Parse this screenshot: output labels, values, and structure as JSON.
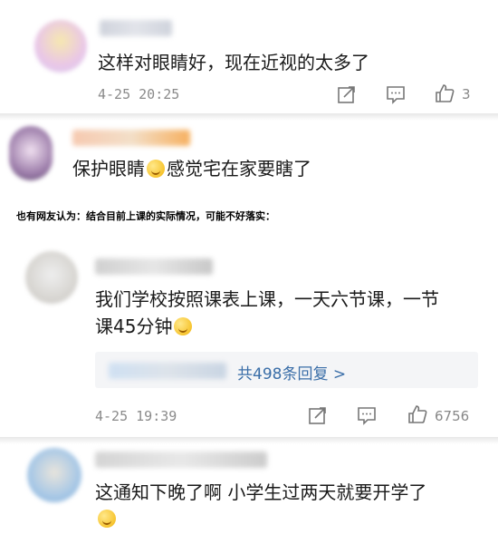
{
  "comments": [
    {
      "text": "这样对眼睛好，现在近视的太多了",
      "time": "4-25 20:25",
      "likes": "3"
    },
    {
      "text_before": "保护眼睛",
      "text_after": "感觉宅在家要瞎了"
    },
    {
      "line1": "我们学校按照课表上课，一天六节课，一节",
      "line2": "课45分钟",
      "replies": "共498条回复 >",
      "time": "4-25 19:39",
      "likes": "6756"
    },
    {
      "text": "这通知下晚了啊 小学生过两天就要开学了"
    }
  ],
  "caption": "也有网友认为：结合目前上课的实际情况，可能不好落实：",
  "icons": [
    "share-icon",
    "comment-icon",
    "like-icon",
    "laugh-cry-emoji",
    "hushed-emoji"
  ],
  "colors": {
    "link": "#3a6ea8",
    "meta": "#8a8a8a",
    "reply_bg": "#f4f5f7"
  }
}
